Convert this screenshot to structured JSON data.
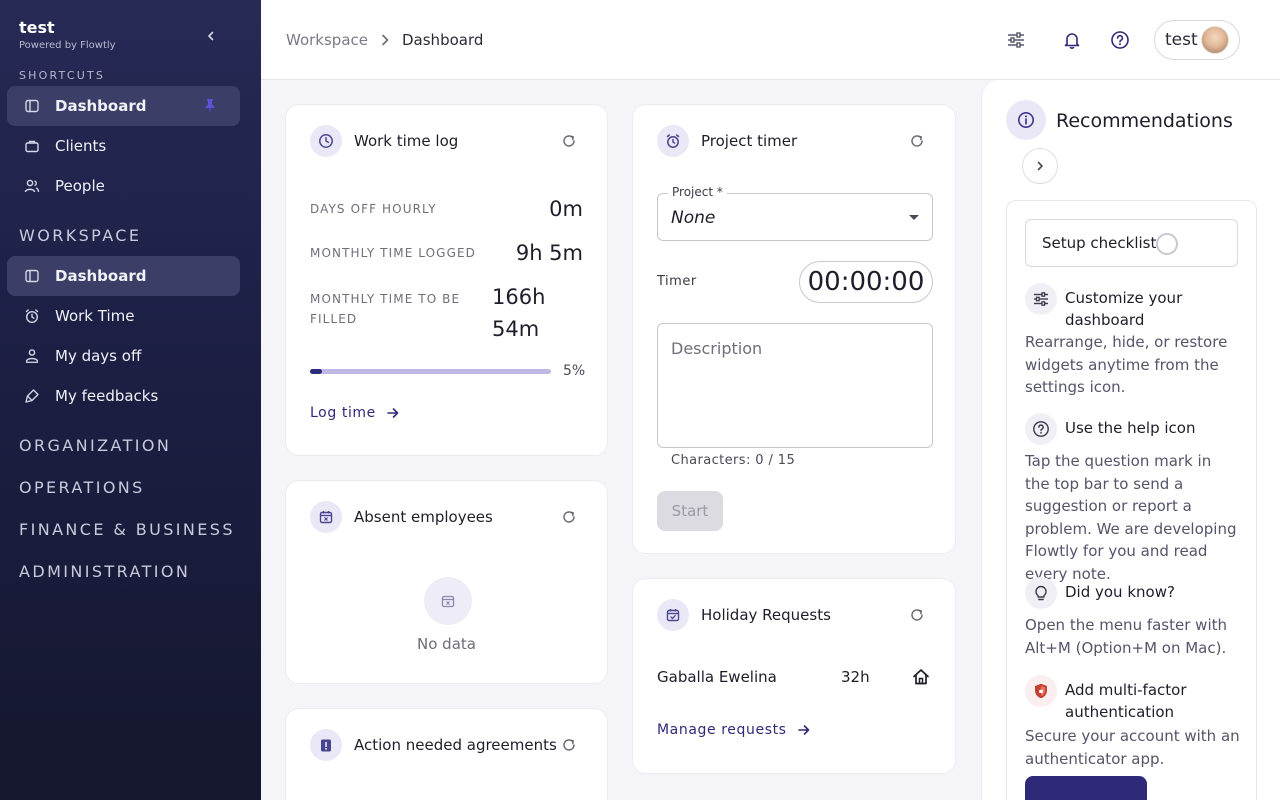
{
  "sidebar": {
    "brand": "test",
    "brand_sub": "Powered by Flowtly",
    "shortcuts_label": "SHORTCUTS",
    "shortcuts": [
      {
        "label": "Dashboard",
        "icon": "dashboard-icon"
      },
      {
        "label": "Clients",
        "icon": "briefcase-icon"
      },
      {
        "label": "People",
        "icon": "people-icon"
      }
    ],
    "workspace_label": "WORKSPACE",
    "workspace": [
      {
        "label": "Dashboard",
        "icon": "dashboard-icon"
      },
      {
        "label": "Work Time",
        "icon": "timer-icon"
      },
      {
        "label": "My days off",
        "icon": "days-off-icon"
      },
      {
        "label": "My feedbacks",
        "icon": "feedback-icon"
      }
    ],
    "sections": [
      "ORGANIZATION",
      "OPERATIONS",
      "FINANCE & BUSINESS",
      "ADMINISTRATION"
    ]
  },
  "header": {
    "breadcrumb": [
      "Workspace",
      "Dashboard"
    ],
    "user": "test"
  },
  "work_time_log": {
    "title": "Work time log",
    "stats": [
      {
        "label": "DAYS OFF HOURLY",
        "value": "0m"
      },
      {
        "label": "MONTHLY TIME LOGGED",
        "value": "9h 5m"
      },
      {
        "label_lines": [
          "MONTHLY TIME TO BE",
          "FILLED"
        ],
        "value_lines": [
          "166h",
          "54m"
        ]
      }
    ],
    "progress_fraction": 0.05,
    "progress_label": "5%",
    "link": "Log time"
  },
  "absent_employees": {
    "title": "Absent employees",
    "empty": "No data"
  },
  "action_agreements": {
    "title": "Action needed agreements"
  },
  "project_timer": {
    "title": "Project timer",
    "project_label": "Project *",
    "project_value": "None",
    "timer_label": "Timer",
    "timer_value": "00:00:00",
    "description_placeholder": "Description",
    "char_count": "Characters: 0 / 15",
    "start": "Start"
  },
  "holiday_requests": {
    "title": "Holiday Requests",
    "rows": [
      {
        "name": "Gaballa Ewelina",
        "hours": "32h"
      }
    ],
    "link": "Manage requests"
  },
  "recommendations": {
    "title": "Recommendations",
    "checklist": "Setup checklist",
    "tips": [
      {
        "title": "Customize your dashboard",
        "body": "Rearrange, hide, or restore widgets anytime from the settings icon."
      },
      {
        "title": "Use the help icon",
        "body": "Tap the question mark in the top bar to send a suggestion or report a problem. We are developing Flowtly for you and read every note."
      },
      {
        "title": "Did you know?",
        "body": "Open the menu faster with Alt+M (Option+M on Mac)."
      },
      {
        "title": "Add multi-factor authentication",
        "body": "Secure your account with an authenticator app."
      }
    ]
  },
  "colors": {
    "sidebar": "#1c1f43",
    "accent": "#2e2a78",
    "active_item": "#3b3e67",
    "progress_track": "#bfb8e4"
  }
}
